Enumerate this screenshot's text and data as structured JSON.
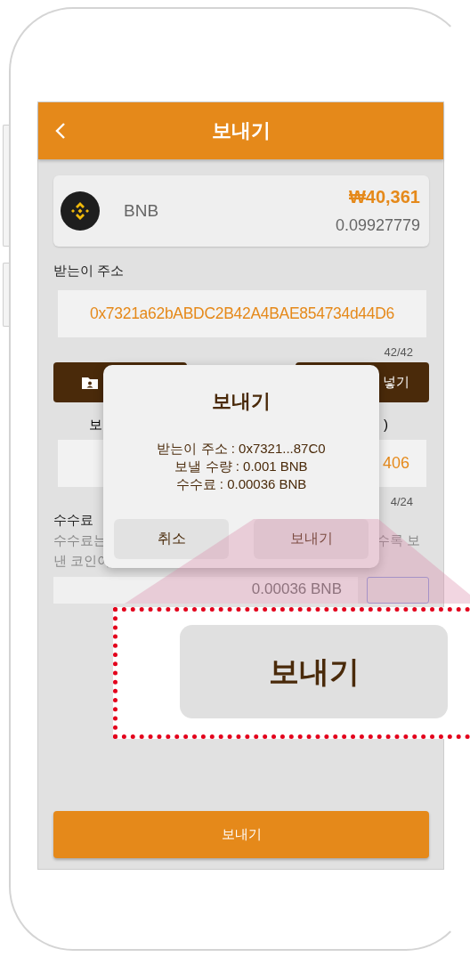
{
  "header": {
    "title": "보내기"
  },
  "coin": {
    "name": "BNB",
    "value": "₩40,361",
    "balance": "0.09927779"
  },
  "recipient": {
    "label": "받는이 주소",
    "value": "0x7321a62bABDC2B42A4BAE854734d44D6",
    "counter": "42/42"
  },
  "action_buttons": [
    {
      "kind": "icon"
    },
    {
      "kind": "text",
      "label": "넣기"
    }
  ],
  "amount": {
    "label_left": "보",
    "label_right": ")",
    "value": "406",
    "counter": "4/24"
  },
  "fee": {
    "label": "수수료",
    "description": [
      {
        "left": "수수료는",
        "right": "수록 보"
      },
      {
        "left": "낸 코인이"
      }
    ],
    "value": "0.00036 BNB"
  },
  "send_button": {
    "label": "보내기"
  },
  "dialog": {
    "title": "보내기",
    "lines": [
      "받는이 주소 : 0x7321...87C0",
      "보낼 수량 : 0.001 BNB",
      "수수료 : 0.00036 BNB"
    ],
    "buttons": [
      {
        "label": "취소"
      },
      {
        "label": "보내기"
      }
    ]
  },
  "callout": {
    "label": "보내기"
  }
}
